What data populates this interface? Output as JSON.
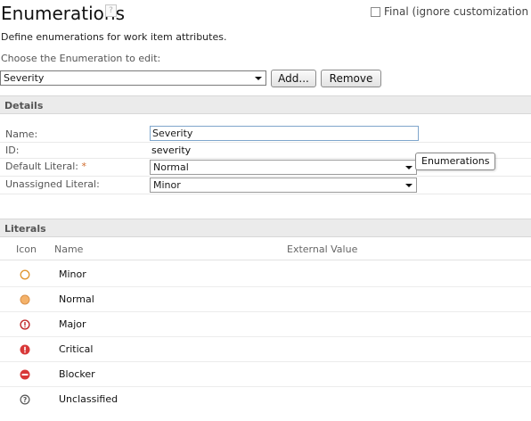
{
  "header": {
    "title": "Enumerations",
    "help_glyph": "?",
    "final_checkbox_label": "Final (ignore customization of",
    "description": "Define enumerations for work item attributes.",
    "choose_label": "Choose the Enumeration to edit:"
  },
  "enum_picker": {
    "selected": "Severity",
    "add_label": "Add...",
    "remove_label": "Remove"
  },
  "details": {
    "section_title": "Details",
    "name_label": "Name:",
    "name_value": "Severity",
    "id_label": "ID:",
    "id_value": "severity",
    "default_literal_label": "Default Literal: ",
    "required_marker": "*",
    "default_literal_value": "Normal",
    "unassigned_literal_label": "Unassigned Literal:",
    "unassigned_literal_value": "Minor",
    "tooltip": "Enumerations"
  },
  "literals": {
    "section_title": "Literals",
    "columns": {
      "icon": "Icon",
      "name": "Name",
      "external_value": "External Value"
    },
    "items": [
      {
        "icon": "circle-outline-icon",
        "name": "Minor",
        "color": "#e0952e"
      },
      {
        "icon": "circle-filled-icon",
        "name": "Normal",
        "color": "#f4b26a"
      },
      {
        "icon": "exclamation-ring-icon",
        "name": "Major",
        "color": "#c0282a"
      },
      {
        "icon": "exclamation-filled-icon",
        "name": "Critical",
        "color": "#d83838"
      },
      {
        "icon": "blocked-icon",
        "name": "Blocker",
        "color": "#d83838"
      },
      {
        "icon": "question-icon",
        "name": "Unclassified",
        "color": "#555555"
      }
    ]
  }
}
